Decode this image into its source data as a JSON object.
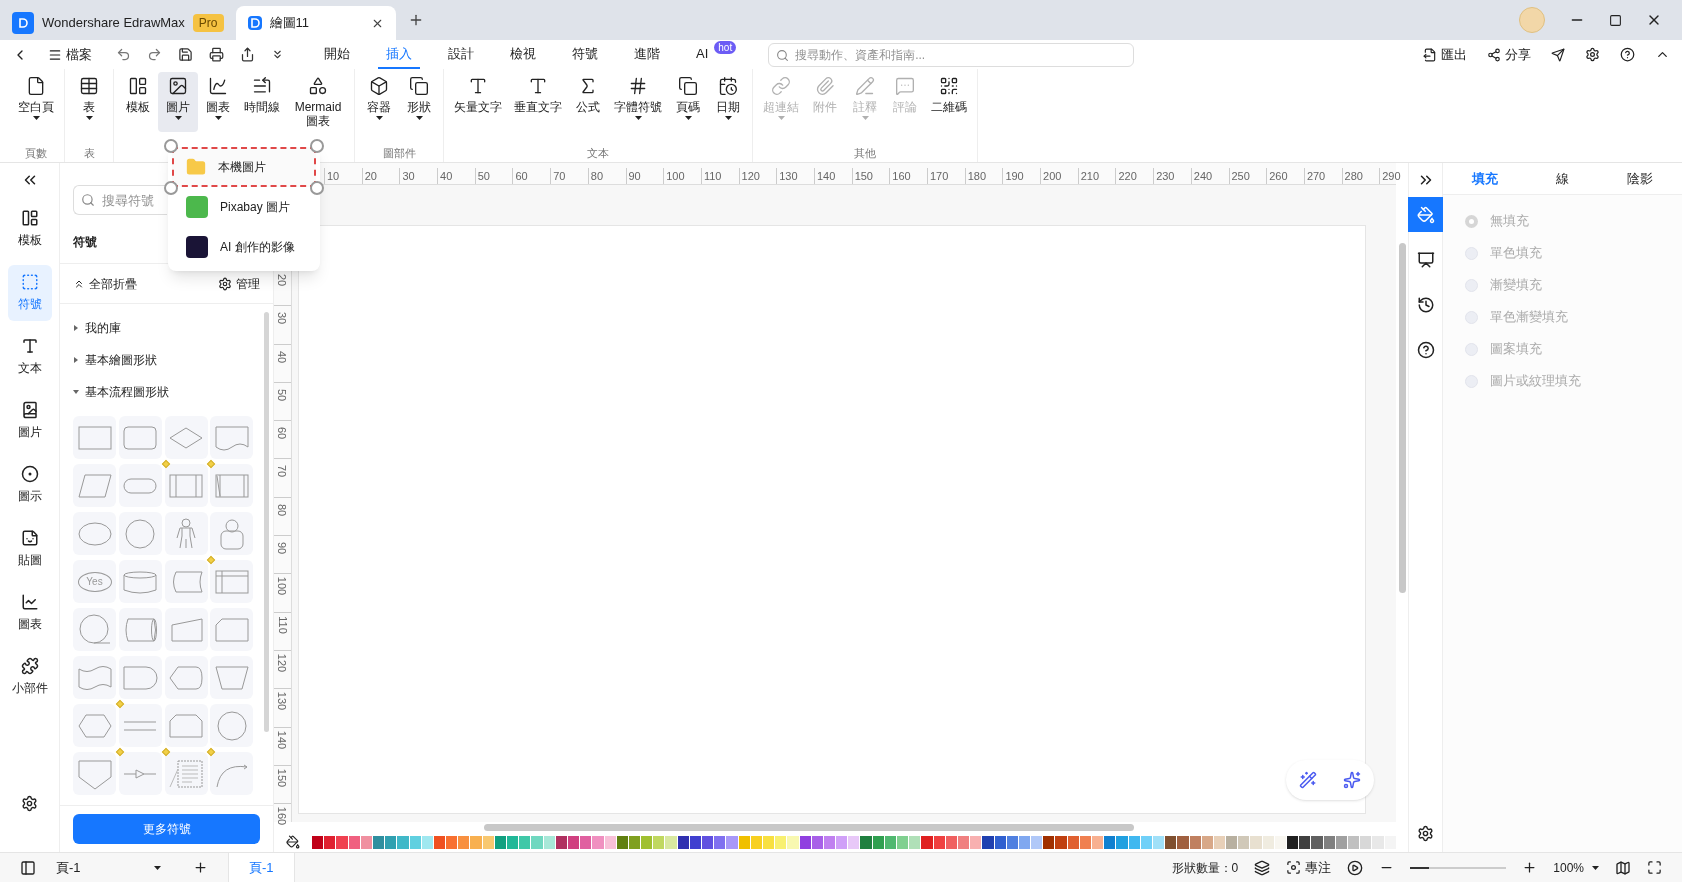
{
  "title_bar": {
    "tabs": [
      {
        "label": "Wondershare EdrawMax",
        "badge": "Pro",
        "selected": false
      },
      {
        "label": "繪圖11",
        "selected": true
      }
    ]
  },
  "menu_bar": {
    "file": "檔案",
    "tabs": [
      {
        "label": "開始",
        "selected": false
      },
      {
        "label": "插入",
        "selected": true
      },
      {
        "label": "設計",
        "selected": false
      },
      {
        "label": "檢視",
        "selected": false
      },
      {
        "label": "符號",
        "selected": false
      },
      {
        "label": "進階",
        "selected": false
      },
      {
        "label": "AI",
        "badge": "hot",
        "selected": false
      }
    ],
    "search": {
      "placeholder": "搜尋動作、資產和指南..."
    },
    "export": "匯出",
    "share": "分享"
  },
  "ribbon": {
    "groups": [
      {
        "label": "頁數",
        "items": [
          {
            "label": "空白頁",
            "dropdown": true,
            "disabled": false,
            "selected": false
          }
        ]
      },
      {
        "label": "表",
        "items": [
          {
            "label": "表",
            "dropdown": true,
            "disabled": false,
            "selected": false
          }
        ]
      },
      {
        "items": [
          {
            "label": "模板",
            "dropdown": false,
            "disabled": false,
            "selected": false
          },
          {
            "label": "圖片",
            "dropdown": true,
            "disabled": false,
            "selected": true
          },
          {
            "label": "圖表",
            "dropdown": true,
            "disabled": false,
            "selected": false
          },
          {
            "label": "時間線",
            "dropdown": false,
            "disabled": false,
            "selected": false
          },
          {
            "label": "Mermaid 圖表",
            "dropdown": false,
            "disabled": false,
            "selected": false
          }
        ]
      },
      {
        "label": "圖部件",
        "items": [
          {
            "label": "容器",
            "dropdown": true,
            "disabled": false,
            "selected": false
          },
          {
            "label": "形狀",
            "dropdown": true,
            "disabled": false,
            "selected": false
          }
        ]
      },
      {
        "label": "文本",
        "items": [
          {
            "label": "矢量文字",
            "dropdown": false,
            "disabled": false,
            "selected": false
          },
          {
            "label": "垂直文字",
            "dropdown": false,
            "disabled": false,
            "selected": false
          },
          {
            "label": "公式",
            "dropdown": false,
            "disabled": false,
            "selected": false
          },
          {
            "label": "字體符號",
            "dropdown": true,
            "disabled": false,
            "selected": false
          },
          {
            "label": "頁碼",
            "dropdown": true,
            "disabled": false,
            "selected": false
          },
          {
            "label": "日期",
            "dropdown": true,
            "disabled": false,
            "selected": false
          }
        ]
      },
      {
        "label": "其他",
        "items": [
          {
            "label": "超連結",
            "dropdown": true,
            "disabled": true,
            "selected": false
          },
          {
            "label": "附件",
            "dropdown": false,
            "disabled": true,
            "selected": false
          },
          {
            "label": "註釋",
            "dropdown": true,
            "disabled": true,
            "selected": false
          },
          {
            "label": "評論",
            "dropdown": false,
            "disabled": true,
            "selected": false
          },
          {
            "label": "二維碼",
            "dropdown": false,
            "disabled": false,
            "selected": false
          }
        ]
      }
    ]
  },
  "image_menu": [
    {
      "label": "本機圖片",
      "selected": true
    },
    {
      "label": "Pixabay 圖片",
      "selected": false
    },
    {
      "label": "AI 創作的影像",
      "selected": false
    }
  ],
  "left_rail": [
    {
      "label": "模板",
      "selected": false
    },
    {
      "label": "符號",
      "selected": true
    },
    {
      "label": "文本",
      "selected": false
    },
    {
      "label": "圖片",
      "selected": false
    },
    {
      "label": "圖示",
      "selected": false
    },
    {
      "label": "貼圖",
      "selected": false
    },
    {
      "label": "圖表",
      "selected": false
    },
    {
      "label": "小部件",
      "selected": false
    }
  ],
  "symbols": {
    "search": {
      "placeholder": "搜尋符號"
    },
    "title": "符號",
    "collapse_all": "全部折疊",
    "manage": "管理",
    "libraries": [
      {
        "label": "我的庫",
        "expanded": false
      },
      {
        "label": "基本繪圖形狀",
        "expanded": false
      },
      {
        "label": "基本流程圖形狀",
        "expanded": true
      }
    ],
    "shapes": [
      {
        "kind": "rect",
        "marked": false
      },
      {
        "kind": "rounded",
        "marked": false
      },
      {
        "kind": "diamond",
        "marked": false
      },
      {
        "kind": "document",
        "marked": false
      },
      {
        "kind": "parallelogram",
        "marked": false
      },
      {
        "kind": "terminator",
        "marked": false
      },
      {
        "kind": "process",
        "marked": true
      },
      {
        "kind": "process2",
        "marked": true
      },
      {
        "kind": "ellipse",
        "marked": false
      },
      {
        "kind": "circle",
        "marked": false
      },
      {
        "kind": "person",
        "marked": false
      },
      {
        "kind": "user",
        "marked": false
      },
      {
        "kind": "label",
        "text": "Yes",
        "marked": false
      },
      {
        "kind": "cylinder",
        "marked": false
      },
      {
        "kind": "stored",
        "marked": false
      },
      {
        "kind": "storage",
        "marked": true
      },
      {
        "kind": "tapecircle",
        "marked": false
      },
      {
        "kind": "drum",
        "marked": false
      },
      {
        "kind": "manualinput",
        "marked": false
      },
      {
        "kind": "card",
        "marked": false
      },
      {
        "kind": "tape",
        "marked": false
      },
      {
        "kind": "delay",
        "marked": false
      },
      {
        "kind": "display",
        "marked": false
      },
      {
        "kind": "manualop",
        "marked": false
      },
      {
        "kind": "hexagon",
        "marked": false
      },
      {
        "kind": "lines",
        "marked": true
      },
      {
        "kind": "loop",
        "marked": false
      },
      {
        "kind": "circle",
        "marked": false
      },
      {
        "kind": "offpage",
        "marked": false
      },
      {
        "kind": "arrowline",
        "marked": true
      },
      {
        "kind": "textblock",
        "marked": true
      },
      {
        "kind": "arc",
        "marked": true
      }
    ],
    "more_button": "更多符號"
  },
  "ruler": {
    "horizontal": [
      "10",
      "20",
      "30",
      "40",
      "50",
      "60",
      "70",
      "80",
      "90",
      "100",
      "110",
      "120",
      "130",
      "140",
      "150",
      "160",
      "170",
      "180",
      "190",
      "200",
      "210",
      "220",
      "230",
      "240",
      "250",
      "260",
      "270",
      "280",
      "290"
    ],
    "vertical": [
      "20",
      "30",
      "40",
      "50",
      "60",
      "70",
      "80",
      "90",
      "100",
      "110",
      "120",
      "130",
      "140",
      "150",
      "160"
    ]
  },
  "right_rail": [
    {
      "selected": true
    },
    {
      "selected": false
    },
    {
      "selected": false
    },
    {
      "selected": false
    }
  ],
  "format_panel": {
    "tabs": [
      {
        "label": "填充",
        "selected": true
      },
      {
        "label": "線",
        "selected": false
      },
      {
        "label": "陰影",
        "selected": false
      }
    ],
    "options": [
      {
        "label": "無填充",
        "selected": true,
        "disabled": true
      },
      {
        "label": "單色填充",
        "selected": false,
        "disabled": true
      },
      {
        "label": "漸變填充",
        "selected": false,
        "disabled": true
      },
      {
        "label": "單色漸變填充",
        "selected": false,
        "disabled": true
      },
      {
        "label": "圖案填充",
        "selected": false,
        "disabled": true
      },
      {
        "label": "圖片或紋理填充",
        "selected": false,
        "disabled": true
      }
    ]
  },
  "palette": [
    {
      "color": "#c00018"
    },
    {
      "color": "#e02030"
    },
    {
      "color": "#f04050"
    },
    {
      "color": "#f06080"
    },
    {
      "color": "#f090a0"
    },
    {
      "color": "#2f8f9f"
    },
    {
      "color": "#30a0b0"
    },
    {
      "color": "#40b8c8"
    },
    {
      "color": "#60d0e0"
    },
    {
      "color": "#a0e8f0"
    },
    {
      "color": "#f05020"
    },
    {
      "color": "#f87030"
    },
    {
      "color": "#f89040"
    },
    {
      "color": "#f8b050"
    },
    {
      "color": "#f8c870"
    },
    {
      "color": "#10a080"
    },
    {
      "color": "#20b898"
    },
    {
      "color": "#40c8a8"
    },
    {
      "color": "#70d8c0"
    },
    {
      "color": "#a8e8d8"
    },
    {
      "color": "#b03060"
    },
    {
      "color": "#d04080"
    },
    {
      "color": "#e060a0"
    },
    {
      "color": "#f090c0"
    },
    {
      "color": "#f8c0d8"
    },
    {
      "color": "#608010"
    },
    {
      "color": "#80a020"
    },
    {
      "color": "#a0c030"
    },
    {
      "color": "#c0d860"
    },
    {
      "color": "#d8e8a0"
    },
    {
      "color": "#3030b0"
    },
    {
      "color": "#4040d0"
    },
    {
      "color": "#6050e0"
    },
    {
      "color": "#8070f0"
    },
    {
      "color": "#a898f8"
    },
    {
      "color": "#f0c000"
    },
    {
      "color": "#f8d020"
    },
    {
      "color": "#f8e040"
    },
    {
      "color": "#f8f070"
    },
    {
      "color": "#f8f8b0"
    },
    {
      "color": "#9040e0"
    },
    {
      "color": "#a860e8"
    },
    {
      "color": "#c080f0"
    },
    {
      "color": "#d0a0f8"
    },
    {
      "color": "#e8c8f8"
    },
    {
      "color": "#208040"
    },
    {
      "color": "#30a050"
    },
    {
      "color": "#50b870"
    },
    {
      "color": "#80d090"
    },
    {
      "color": "#b0e0b8"
    },
    {
      "color": "#e02020"
    },
    {
      "color": "#f04040"
    },
    {
      "color": "#f06060"
    },
    {
      "color": "#f08080"
    },
    {
      "color": "#f8b0b0"
    },
    {
      "color": "#2040b0"
    },
    {
      "color": "#3060d0"
    },
    {
      "color": "#5080e0"
    },
    {
      "color": "#80a8f0"
    },
    {
      "color": "#b0c8f8"
    },
    {
      "color": "#a03000"
    },
    {
      "color": "#c04010"
    },
    {
      "color": "#e06030"
    },
    {
      "color": "#f08050"
    },
    {
      "color": "#f8b090"
    },
    {
      "color": "#1080d0"
    },
    {
      "color": "#20a0e0"
    },
    {
      "color": "#40b8f0"
    },
    {
      "color": "#70d0f8"
    },
    {
      "color": "#a0e0f8"
    },
    {
      "color": "#805030"
    },
    {
      "color": "#a06040"
    },
    {
      "color": "#c08060"
    },
    {
      "color": "#d8a888"
    },
    {
      "color": "#e8d0b8"
    },
    {
      "color": "#b8b0a0"
    },
    {
      "color": "#d0c8b8"
    },
    {
      "color": "#e8e0d0"
    },
    {
      "color": "#f0ece0"
    },
    {
      "color": "#f8f6f0"
    },
    {
      "color": "#202020"
    },
    {
      "color": "#404040"
    },
    {
      "color": "#606060"
    },
    {
      "color": "#808080"
    },
    {
      "color": "#a0a0a0"
    },
    {
      "color": "#c0c0c0"
    },
    {
      "color": "#d8d8d8"
    },
    {
      "color": "#e8e8e8"
    },
    {
      "color": "#f4f4f4"
    }
  ],
  "status_bar": {
    "page_select": "頁-1",
    "pages": [
      {
        "label": "頁-1",
        "selected": true
      }
    ],
    "shape_count": "形狀數量：0",
    "focus": "專注",
    "zoom": "100%",
    "level": 0.2
  }
}
